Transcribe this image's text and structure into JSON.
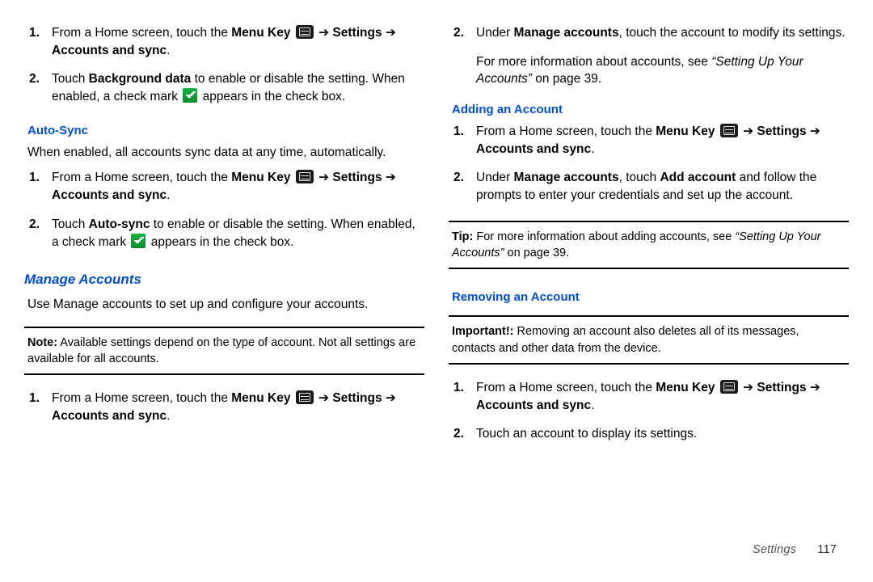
{
  "arrow_glyph": "➔",
  "top_steps": [
    {
      "pre": "From a Home screen, touch the ",
      "menu_key": "Menu Key",
      "has_icon": true,
      "path1": "Settings",
      "path2": "Accounts and sync",
      "post": "."
    },
    {
      "full": "Touch <b>Background data</b> to enable or disable the setting. When enabled, a check mark {CHECK} appears in the check box."
    }
  ],
  "auto_sync": {
    "heading": "Auto-Sync",
    "intro": "When enabled, all accounts sync data at any time, automatically.",
    "steps": [
      {
        "pre": "From a Home screen, touch the ",
        "menu_key": "Menu Key",
        "has_icon": true,
        "path1": "Settings",
        "path2": "Accounts and sync",
        "post": "."
      },
      {
        "full": "Touch <b>Auto-sync</b> to enable or disable the setting. When enabled, a check mark {CHECK} appears in the check box."
      }
    ]
  },
  "manage_accounts": {
    "heading": "Manage Accounts",
    "intro": "Use Manage accounts to set up and configure your accounts.",
    "note_lead": "Note:",
    "note_body": " Available settings depend on the type of account. Not all settings are available for all accounts.",
    "steps_a": [
      {
        "pre": "From a Home screen, touch the ",
        "menu_key": "Menu Key",
        "has_icon": true,
        "path1": "Settings",
        "path2": "Accounts and sync",
        "post": "."
      }
    ],
    "steps_b": [
      {
        "full": "Under <b>Manage accounts</b>, touch the account to modify its settings."
      }
    ],
    "xref_pre": "For more information about accounts, see ",
    "xref_title": "“Setting Up Your Accounts”",
    "xref_post": " on page 39."
  },
  "adding": {
    "heading": "Adding an Account",
    "steps": [
      {
        "pre": "From a Home screen, touch the ",
        "menu_key": "Menu Key",
        "has_icon": true,
        "path1": "Settings",
        "path2": "Accounts and sync",
        "post": "."
      },
      {
        "full": "Under <b>Manage accounts</b>, touch <b>Add account</b> and follow the prompts to enter your credentials and set up the account."
      }
    ],
    "tip_lead": "Tip:",
    "tip_body": " For more information about adding accounts, see ",
    "tip_xref_title": "“Setting Up Your Accounts”",
    "tip_xref_post": " on page 39."
  },
  "removing": {
    "heading": "Removing an Account",
    "imp_lead": "Important!:",
    "imp_body": " Removing an account also deletes all of its messages, contacts and other data from the device.",
    "steps": [
      {
        "pre": "From a Home screen, touch the ",
        "menu_key": "Menu Key",
        "has_icon": true,
        "path1": "Settings",
        "path2": "Accounts and sync",
        "post": "."
      },
      {
        "full": "Touch an account to display its settings."
      }
    ]
  },
  "footer": {
    "section": "Settings",
    "page": "117"
  }
}
